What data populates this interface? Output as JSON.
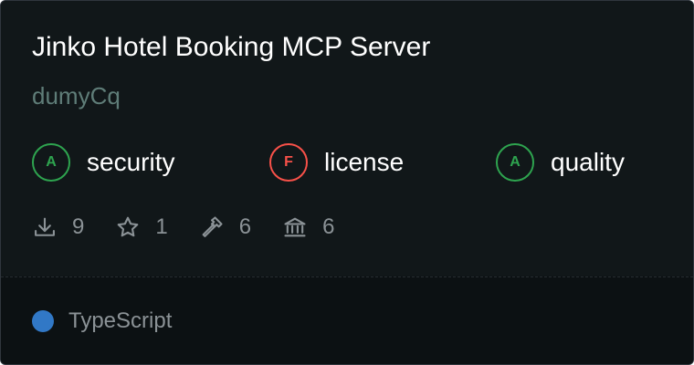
{
  "card": {
    "title": "Jinko Hotel Booking MCP Server",
    "owner": "dumyCq"
  },
  "grades": [
    {
      "letter": "A",
      "label": "security",
      "color": "#2ea44f"
    },
    {
      "letter": "F",
      "label": "license",
      "color": "#f85149"
    },
    {
      "letter": "A",
      "label": "quality",
      "color": "#2ea44f"
    }
  ],
  "stats": {
    "downloads": "9",
    "stars": "1",
    "tools": "6",
    "institutions": "6"
  },
  "language": {
    "name": "TypeScript",
    "color": "#3178c6"
  }
}
